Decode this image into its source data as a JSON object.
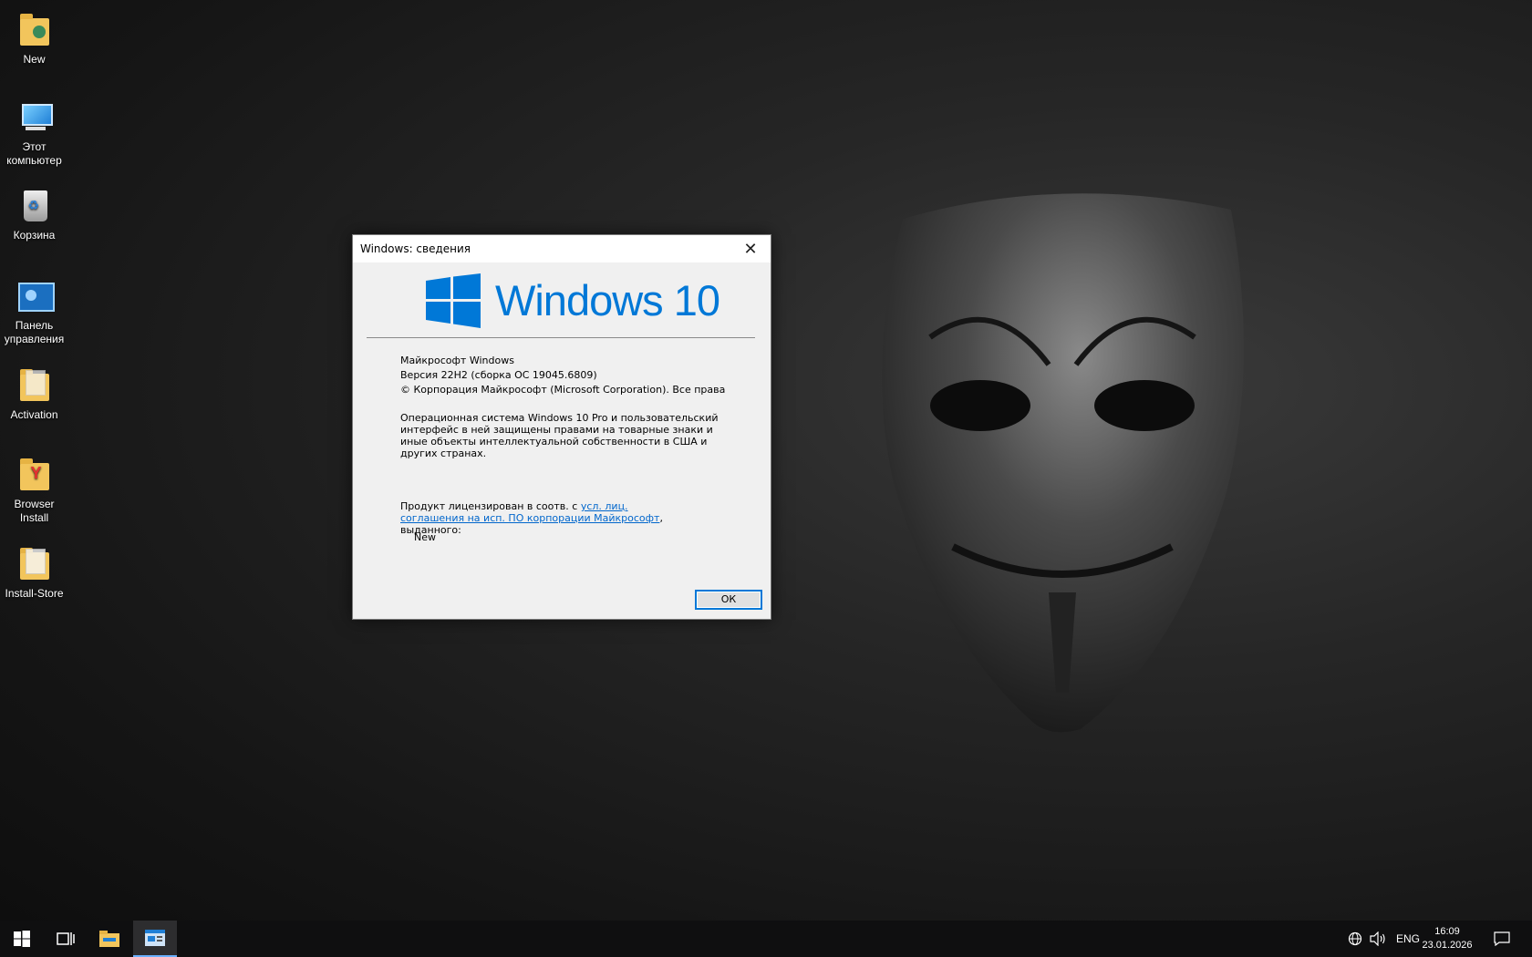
{
  "desktop": {
    "icons": [
      {
        "label": "New",
        "icon": "user-folder-icon"
      },
      {
        "label": "Этот компьютер",
        "icon": "computer-icon"
      },
      {
        "label": "Корзина",
        "icon": "recycle-bin-icon"
      },
      {
        "label": "Панель управления",
        "icon": "control-panel-icon"
      },
      {
        "label": "Activation",
        "icon": "folder-icon"
      },
      {
        "label": "Browser Install",
        "icon": "folder-icon"
      },
      {
        "label": "Install-Store",
        "icon": "folder-icon"
      }
    ]
  },
  "dialog": {
    "title": "Windows: сведения",
    "logo_text": "Windows 10",
    "product": "Майкрософт Windows",
    "version": "Версия 22H2 (сборка ОС 19045.6809)",
    "copyright": "© Корпорация Майкрософт (Microsoft Corporation). Все права",
    "description": "Операционная система Windows 10 Pro и пользовательский интерфейс в ней защищены правами на товарные знаки и иные объекты интеллектуальной собственности в США и других странах.",
    "license_prefix": "Продукт лицензирован в соотв. с ",
    "license_link": "усл. лиц. соглашения на исп. ПО корпорации Майкрософт",
    "license_suffix": ", выданного:",
    "licensed_to": "New",
    "ok_label": "ОК",
    "colors": {
      "brand": "#0078d7",
      "link": "#0066cc"
    }
  },
  "taskbar": {
    "start_icon": "windows-start-icon",
    "task_view_icon": "task-view-icon",
    "explorer_icon": "file-explorer-icon",
    "active_app_icon": "winver-app-icon",
    "language": "ENG",
    "time": "16:09",
    "date": "23.01.2026"
  }
}
